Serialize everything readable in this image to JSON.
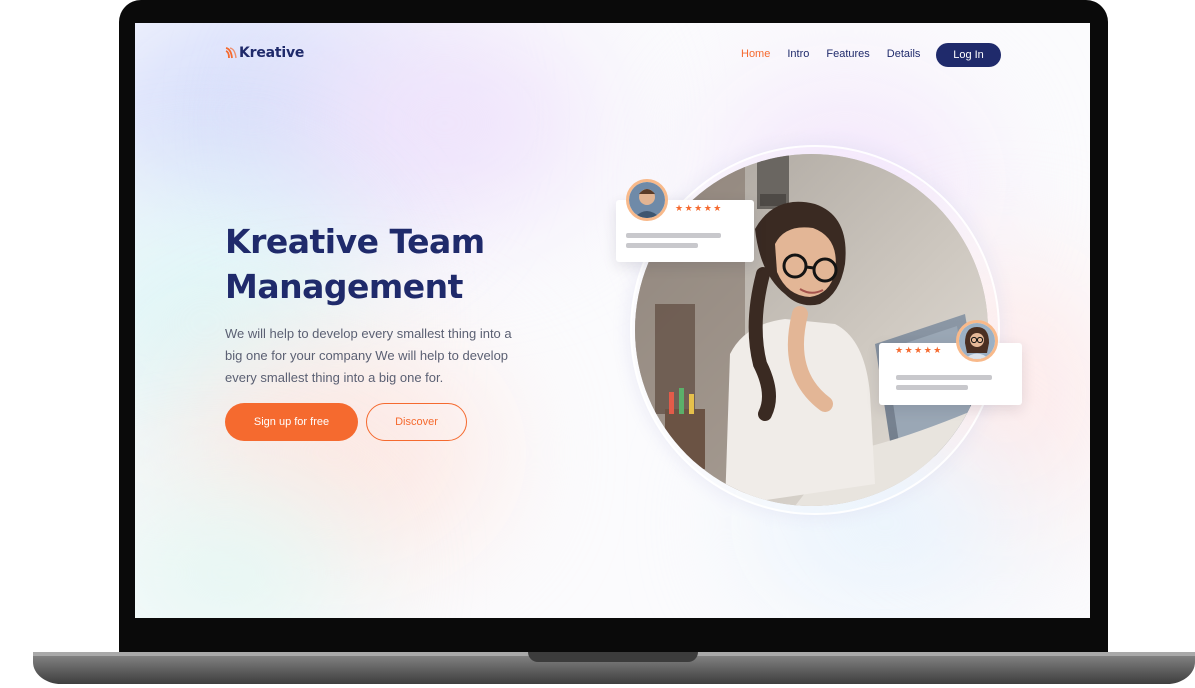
{
  "brand": {
    "name": "Kreative",
    "colors": {
      "accent": "#f56a2f",
      "primary": "#1f2a6b"
    }
  },
  "nav": {
    "items": [
      {
        "label": "Home",
        "active": true
      },
      {
        "label": "Intro",
        "active": false
      },
      {
        "label": "Features",
        "active": false
      },
      {
        "label": "Details",
        "active": false
      }
    ],
    "login_label": "Log In"
  },
  "hero": {
    "title_line1": "Kreative Team",
    "title_line2": "Management",
    "description": "We will help to develop every smallest thing into a big one for your company We will help to develop every smallest thing into a big one for.",
    "primary_cta": "Sign up for free",
    "secondary_cta": "Discover"
  },
  "reviews": [
    {
      "stars": "★★★★★",
      "rating": 5
    },
    {
      "stars": "★★★★★",
      "rating": 5
    }
  ],
  "icons": [
    "logo-mark-icon",
    "star-icon",
    "avatar-icon"
  ]
}
